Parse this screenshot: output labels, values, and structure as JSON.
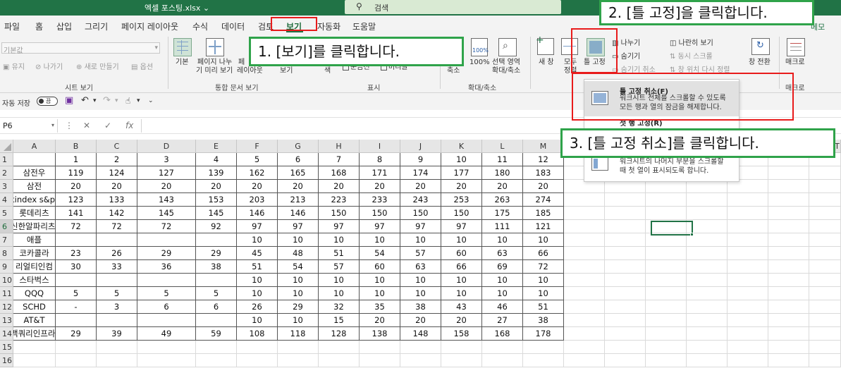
{
  "titlebar": {
    "filename": "엑셀 포스팅.xlsx ⌄",
    "search": "검색"
  },
  "menu": [
    "파일",
    "홈",
    "삽입",
    "그리기",
    "페이지 레이아웃",
    "수식",
    "데이터",
    "검토",
    "보기",
    "자동화",
    "도움말"
  ],
  "memo_label": "메모",
  "ribbon": {
    "sheet_view": {
      "dropdown": "기본값",
      "keep": "유지",
      "exit": "나가기",
      "new": "새로 만들기",
      "options": "옵션",
      "group": "시트 보기"
    },
    "workbook_views": {
      "normal": "기본",
      "page_break_1": "페이지 나누",
      "page_break_2": "기 미리 보기",
      "page_layout_1": "페",
      "page_layout_2": "레이아웃",
      "custom": "보기",
      "group": "통합 문서 보기"
    },
    "show": {
      "show_label": "색",
      "gridlines": "눈금선",
      "headings": "머리글",
      "group": "표시"
    },
    "zoom": {
      "zoom": "축소",
      "zoom100": "100%",
      "zoom100_label": "100%",
      "zoom_sel_1": "선택 영역",
      "zoom_sel_2": "확대/축소",
      "group": "확대/축소"
    },
    "window": {
      "new": "새 창",
      "arrange_1": "모두",
      "arrange_2": "정렬",
      "freeze": "틀 고정",
      "split": "나누기",
      "hide": "숨기기",
      "unhide": "숨기기 취소",
      "side_by_side": "나란히 보기",
      "sync_scroll": "동시 스크롤",
      "reset_pos": "창 위치 다시 정렬",
      "switch": "창 전환"
    },
    "macros": {
      "label": "매크로",
      "group": "매크로"
    }
  },
  "qat": {
    "autosave": "자동 저장",
    "toggle": "끔"
  },
  "formula_bar": {
    "name_box": "P6",
    "fx": "fx"
  },
  "columns": [
    "A",
    "B",
    "C",
    "D",
    "E",
    "F",
    "G",
    "H",
    "I",
    "J",
    "K",
    "L",
    "M"
  ],
  "row_numbers": [
    "1",
    "2",
    "3",
    "4",
    "5",
    "6",
    "7",
    "8",
    "9",
    "10",
    "11",
    "12",
    "13",
    "14",
    "15",
    "16"
  ],
  "right_col_header": "T",
  "table": {
    "header": [
      "",
      "1",
      "2",
      "3",
      "4",
      "5",
      "6",
      "7",
      "8",
      "9",
      "10",
      "11",
      "12"
    ],
    "rows": [
      {
        "name": "삼전우",
        "values": [
          "119",
          "124",
          "127",
          "139",
          "162",
          "165",
          "168",
          "171",
          "174",
          "177",
          "180",
          "183"
        ]
      },
      {
        "name": "삼전",
        "values": [
          "20",
          "20",
          "20",
          "20",
          "20",
          "20",
          "20",
          "20",
          "20",
          "20",
          "20",
          "20"
        ]
      },
      {
        "name": "kindex s&p",
        "values": [
          "123",
          "133",
          "143",
          "153",
          "203",
          "213",
          "223",
          "233",
          "243",
          "253",
          "263",
          "274"
        ]
      },
      {
        "name": "롯데리츠",
        "values": [
          "141",
          "142",
          "145",
          "145",
          "146",
          "146",
          "150",
          "150",
          "150",
          "150",
          "175",
          "185"
        ]
      },
      {
        "name": "신한알파리츠",
        "values": [
          "72",
          "72",
          "72",
          "92",
          "97",
          "97",
          "97",
          "97",
          "97",
          "97",
          "111",
          "121"
        ]
      },
      {
        "name": "애플",
        "values": [
          "",
          "",
          "",
          "",
          "10",
          "10",
          "10",
          "10",
          "10",
          "10",
          "10",
          "10"
        ]
      },
      {
        "name": "코카콜라",
        "values": [
          "23",
          "26",
          "29",
          "29",
          "45",
          "48",
          "51",
          "54",
          "57",
          "60",
          "63",
          "66"
        ]
      },
      {
        "name": "리얼티인컴",
        "values": [
          "30",
          "33",
          "36",
          "38",
          "51",
          "54",
          "57",
          "60",
          "63",
          "66",
          "69",
          "72"
        ]
      },
      {
        "name": "스타벅스",
        "values": [
          "",
          "",
          "",
          "",
          "10",
          "10",
          "10",
          "10",
          "10",
          "10",
          "10",
          "10"
        ]
      },
      {
        "name": "QQQ",
        "values": [
          "5",
          "5",
          "5",
          "5",
          "10",
          "10",
          "10",
          "10",
          "10",
          "10",
          "10",
          "10"
        ]
      },
      {
        "name": "SCHD",
        "values": [
          "-",
          "3",
          "6",
          "6",
          "26",
          "29",
          "32",
          "35",
          "38",
          "43",
          "46",
          "51"
        ]
      },
      {
        "name": "AT&T",
        "values": [
          "",
          "",
          "",
          "",
          "10",
          "10",
          "15",
          "20",
          "20",
          "20",
          "27",
          "38"
        ]
      },
      {
        "name": "맥쿼리인프라",
        "values": [
          "29",
          "39",
          "49",
          "59",
          "108",
          "118",
          "128",
          "138",
          "148",
          "158",
          "168",
          "178"
        ]
      }
    ]
  },
  "freeze_menu": {
    "unfreeze_title": "틀 고정 취소(F)",
    "unfreeze_desc_1": "워크시트 전체를 스크롤할 수 있도록",
    "unfreeze_desc_2": "모든 행과 열의 잠금을 해제합니다.",
    "top_row_title": "첫 행 고정(R)",
    "first_col_desc_1": "워크시트의 나머지 부분을 스크롤할",
    "first_col_desc_2": "때 첫 열이 표시되도록 합니다."
  },
  "callouts": {
    "step1": "1. [보기]를 클릭합니다.",
    "step2": "2. [틀 고정]을 클릭합니다.",
    "step3": "3. [틀 고정 취소]를 클릭합니다."
  },
  "colors": {
    "excel_green": "#217346",
    "callout_border": "#2fa34a",
    "highlight_red": "#e81b1b"
  }
}
